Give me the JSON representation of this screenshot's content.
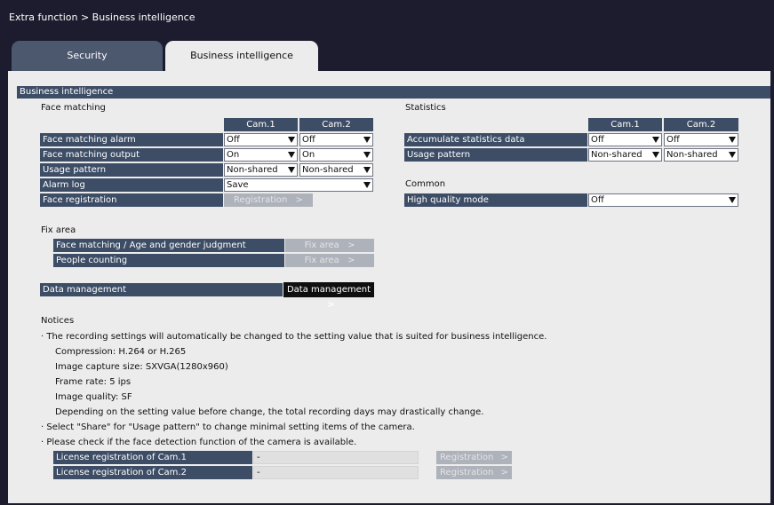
{
  "breadcrumb": "Extra function > Business intelligence",
  "tabs": [
    {
      "label": "Security"
    },
    {
      "label": "Business intelligence"
    }
  ],
  "section_title": "Business intelligence",
  "face_matching": {
    "title": "Face matching",
    "cam_headers": [
      "Cam.1",
      "Cam.2"
    ],
    "rows": [
      {
        "label": "Face matching alarm",
        "cam1": "Off",
        "cam2": "Off"
      },
      {
        "label": "Face matching output",
        "cam1": "On",
        "cam2": "On"
      },
      {
        "label": "Usage pattern",
        "cam1": "Non-shared",
        "cam2": "Non-shared"
      },
      {
        "label": "Alarm log",
        "value": "Save"
      },
      {
        "label": "Face registration",
        "button": "Registration"
      }
    ]
  },
  "statistics": {
    "title": "Statistics",
    "cam_headers": [
      "Cam.1",
      "Cam.2"
    ],
    "rows": [
      {
        "label": "Accumulate statistics data",
        "cam1": "Off",
        "cam2": "Off"
      },
      {
        "label": "Usage pattern",
        "cam1": "Non-shared",
        "cam2": "Non-shared"
      }
    ]
  },
  "common": {
    "title": "Common",
    "rows": [
      {
        "label": "High quality mode",
        "value": "Off"
      }
    ]
  },
  "fix_area": {
    "title": "Fix area",
    "rows": [
      {
        "label": "Face matching / Age and gender judgment",
        "button": "Fix area"
      },
      {
        "label": "People counting",
        "button": "Fix area"
      }
    ]
  },
  "data_management": {
    "label": "Data management",
    "button": "Data management"
  },
  "notices": {
    "title": "Notices",
    "lines": [
      "· The recording settings will automatically be changed to the setting value that is suited for business intelligence.",
      "Compression: H.264 or H.265",
      "Image capture size: SXVGA(1280x960)",
      "Frame rate: 5 ips",
      "Image quality: SF",
      "Depending on the setting value before change, the total recording days may drastically change.",
      "· Select \"Share\" for \"Usage pattern\" to change minimal setting items of the camera.",
      "· Please check if the face detection function of the camera is available."
    ]
  },
  "license": {
    "rows": [
      {
        "label": "License registration of Cam.1",
        "value": "-",
        "button": "Registration"
      },
      {
        "label": "License registration of Cam.2",
        "value": "-",
        "button": "Registration"
      }
    ]
  },
  "icons": {
    "dropdown": "chevron-down-icon",
    "button_arrow": "chevron-right-icon"
  },
  "colors": {
    "header_bg": "#1c1c2e",
    "label_bg": "#3d4d66",
    "panel_bg": "#ececec",
    "tab_inactive": "#4b586e",
    "disabled_button": "#aeb2ba",
    "dark_button": "#0f0f10"
  }
}
